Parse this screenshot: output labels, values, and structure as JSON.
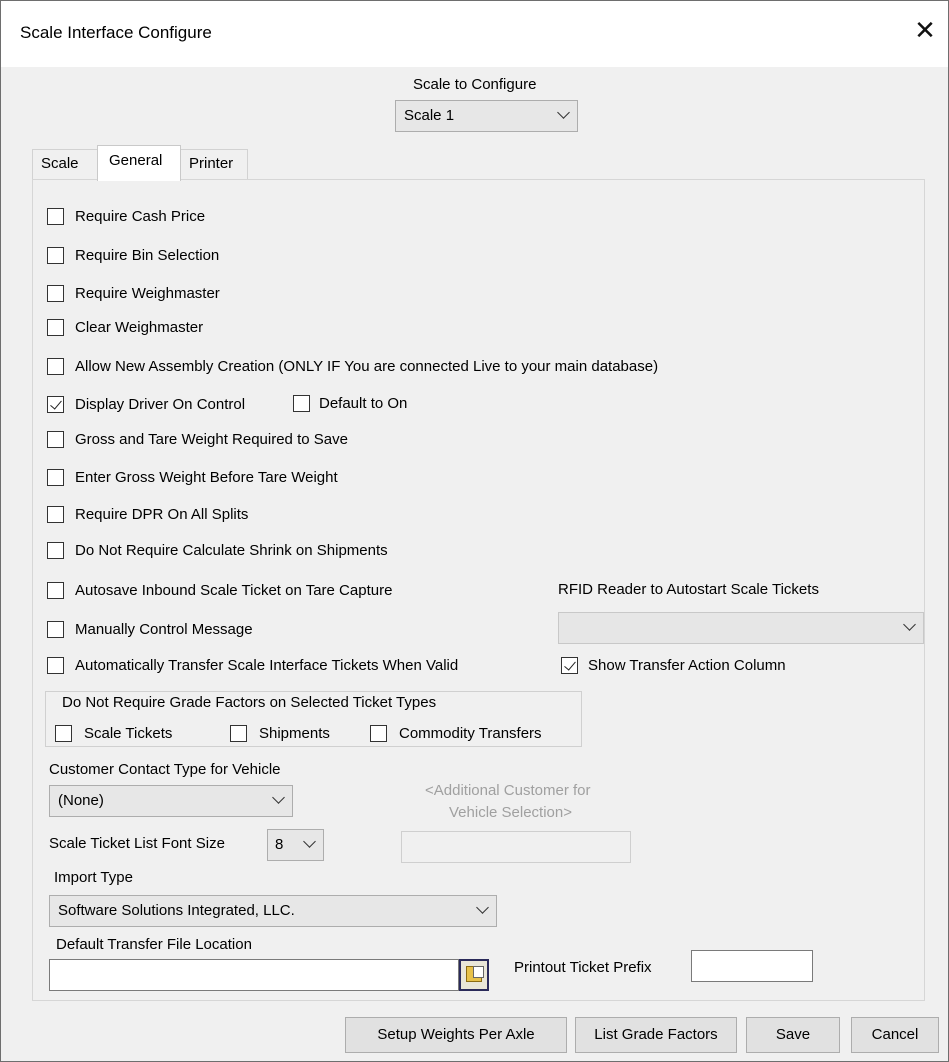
{
  "window": {
    "title": "Scale Interface Configure"
  },
  "scale_select": {
    "label": "Scale to Configure",
    "value": "Scale 1"
  },
  "tabs": [
    {
      "label": "Scale"
    },
    {
      "label": "General"
    },
    {
      "label": "Printer"
    }
  ],
  "options": [
    {
      "label": "Require Cash Price",
      "checked": false
    },
    {
      "label": "Require Bin Selection",
      "checked": false
    },
    {
      "label": "Require Weighmaster",
      "checked": false
    },
    {
      "label": "Clear Weighmaster",
      "checked": false
    },
    {
      "label": "Allow New Assembly Creation (ONLY IF You are connected Live to your main database)",
      "checked": false
    },
    {
      "label": "Display Driver On Control",
      "checked": true
    },
    {
      "label": "Gross and Tare Weight Required to Save",
      "checked": false
    },
    {
      "label": "Enter Gross Weight Before Tare Weight",
      "checked": false
    },
    {
      "label": "Require DPR On All Splits",
      "checked": false
    },
    {
      "label": "Do Not Require Calculate Shrink on Shipments",
      "checked": false
    },
    {
      "label": "Autosave Inbound Scale Ticket on Tare Capture",
      "checked": false
    },
    {
      "label": "Manually Control Message",
      "checked": false
    },
    {
      "label": "Automatically Transfer Scale Interface Tickets When Valid",
      "checked": false
    }
  ],
  "default_to_on": {
    "label": "Default to On",
    "checked": false
  },
  "rfid": {
    "label": "RFID Reader to Autostart Scale Tickets",
    "value": ""
  },
  "show_transfer": {
    "label": "Show Transfer Action Column",
    "checked": true
  },
  "grade_group": {
    "title": "Do Not Require Grade Factors on Selected Ticket Types",
    "items": [
      {
        "label": "Scale Tickets",
        "checked": false
      },
      {
        "label": "Shipments",
        "checked": false
      },
      {
        "label": "Commodity Transfers",
        "checked": false
      }
    ]
  },
  "contact_type": {
    "label": "Customer Contact Type for Vehicle",
    "value": "(None)"
  },
  "additional_customer": {
    "label_line1": "<Additional Customer for",
    "label_line2": "Vehicle Selection>",
    "value": ""
  },
  "font_size": {
    "label": "Scale Ticket List Font Size",
    "value": "8"
  },
  "import_type": {
    "label": "Import Type",
    "value": "Software Solutions Integrated, LLC."
  },
  "transfer_file": {
    "label": "Default Transfer File Location",
    "value": ""
  },
  "ticket_prefix": {
    "label": "Printout Ticket Prefix",
    "value": ""
  },
  "buttons": {
    "setup_weights": "Setup Weights Per Axle",
    "list_grade": "List Grade Factors",
    "save": "Save",
    "cancel": "Cancel"
  }
}
